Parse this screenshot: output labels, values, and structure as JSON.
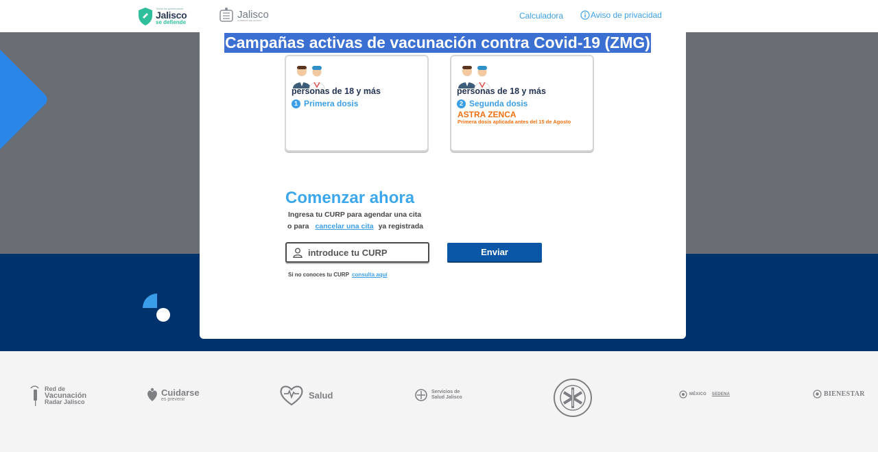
{
  "header": {
    "brand_small": "Todos los gobernamos",
    "brand_main": "Jalisco",
    "brand_sub": "se defiende",
    "gov_name": "Jalisco",
    "gov_sub": "GOBIERNO DEL ESTADO",
    "nav": {
      "calculator": "Calculadora",
      "privacy": "Aviso de privacidad"
    }
  },
  "modal": {
    "title": "Campañas activas de vacunación contra Covid-19 (ZMG)",
    "campaigns": [
      {
        "audience": "personas de 18 y más",
        "dose_number": "1",
        "dose_label": "Primera dosis",
        "vaccine": "",
        "note": ""
      },
      {
        "audience": "personas de 18 y más",
        "dose_number": "2",
        "dose_label": "Segunda dosis",
        "vaccine": "ASTRA ZENCA",
        "note": "Primera dosis aplicada antes del 15 de Agosto"
      }
    ],
    "start": {
      "title": "Comenzar ahora",
      "line1": "Ingresa tu CURP para agendar una cita",
      "line2_prefix": "o para",
      "line2_link": "cancelar una cita",
      "line2_suffix": "ya registrada",
      "input_placeholder": "introduce tu CURP",
      "input_value": "",
      "submit_label": "Enviar",
      "hint_prefix": "Si no conoces tu CURP",
      "hint_link": "consulta aquí"
    }
  },
  "footer": {
    "partners": {
      "red_line1": "Red de",
      "red_line2": "Vacunación",
      "red_line3": "Radar Jalisco",
      "cuidarse": "Cuidarse",
      "cuidarse_sub": "es prevenir",
      "salud": "Salud",
      "servicios_line1": "Servicios de",
      "servicios_line2": "Salud Jalisco",
      "mexico": "MÉXICO",
      "sedena": "SEDENA",
      "bienestar": "BIENESTAR"
    }
  },
  "colors": {
    "accent": "#3b9fe8",
    "navy": "#00336c",
    "grey_band": "#6a6d73",
    "title_highlight": "#3b6fd1",
    "button": "#0a57a8",
    "warning": "#f07010"
  }
}
